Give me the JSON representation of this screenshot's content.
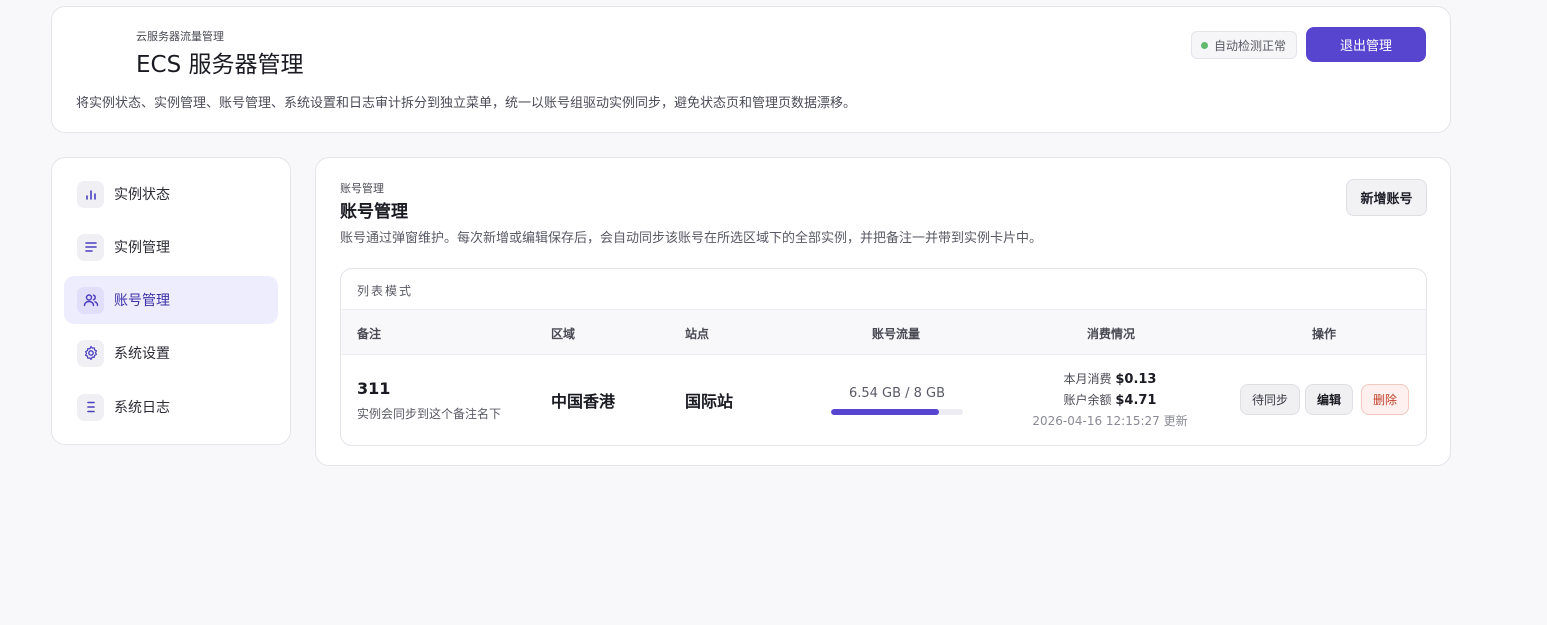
{
  "header": {
    "eyebrow": "云服务器流量管理",
    "title": "ECS 服务器管理",
    "subtitle": "将实例状态、实例管理、账号管理、系统设置和日志审计拆分到独立菜单，统一以账号组驱动实例同步，避免状态页和管理页数据漂移。",
    "status_text": "自动检测正常",
    "status_color": "#62b86d",
    "exit_label": "退出管理",
    "accent": "#5745d0"
  },
  "sidebar": {
    "items": [
      {
        "label": "实例状态",
        "icon": "bar-chart-icon",
        "active": false
      },
      {
        "label": "实例管理",
        "icon": "lines-icon",
        "active": false
      },
      {
        "label": "账号管理",
        "icon": "users-icon",
        "active": true
      },
      {
        "label": "系统设置",
        "icon": "gear-icon",
        "active": false
      },
      {
        "label": "系统日志",
        "icon": "list-icon",
        "active": false
      }
    ]
  },
  "main": {
    "eyebrow": "账号管理",
    "title": "账号管理",
    "description": "账号通过弹窗维护。每次新增或编辑保存后，会自动同步该账号在所选区域下的全部实例，并把备注一并带到实例卡片中。",
    "add_label": "新增账号",
    "table": {
      "mode_label": "列表模式",
      "columns": [
        "备注",
        "区域",
        "站点",
        "账号流量",
        "消费情况",
        "操作"
      ],
      "rows": [
        {
          "note": "311",
          "note_sub": "实例会同步到这个备注名下",
          "region": "中国香港",
          "site": "国际站",
          "traffic_text": "6.54 GB / 8 GB",
          "traffic_used_fraction": 0.8175,
          "cost_month_label": "本月消费",
          "cost_month_value": "$0.13",
          "balance_label": "账户余额",
          "balance_value": "$4.71",
          "updated": "2026-04-16 12:15:27 更新",
          "actions": {
            "pending": "待同步",
            "edit": "编辑",
            "delete": "删除"
          }
        }
      ]
    }
  }
}
